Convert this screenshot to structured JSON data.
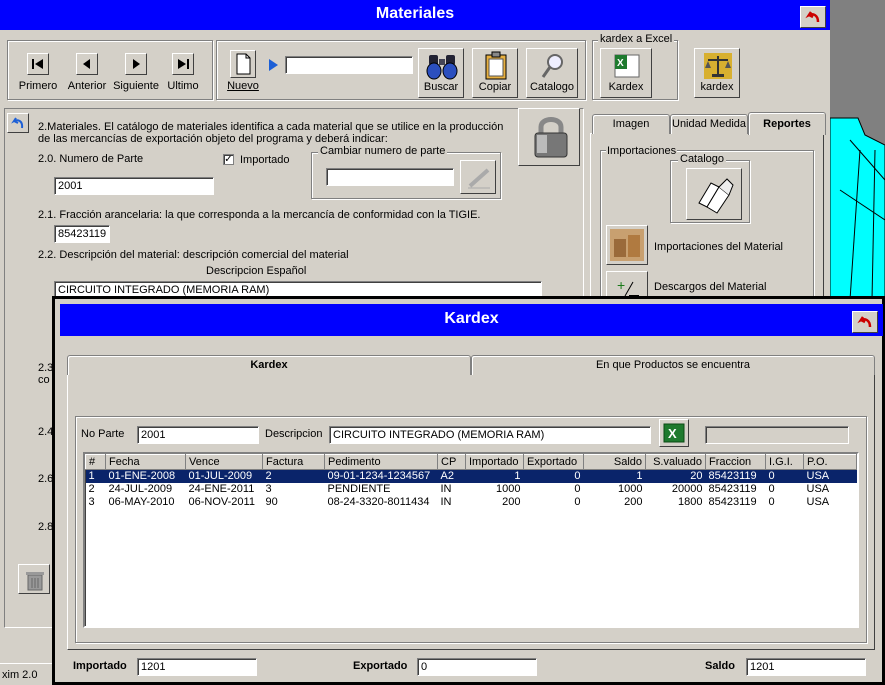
{
  "main_window": {
    "title": "Materiales",
    "nav_buttons": [
      {
        "label": "Primero"
      },
      {
        "label": "Anterior"
      },
      {
        "label": "Siguiente"
      },
      {
        "label": "Ultimo"
      }
    ],
    "new_button": "Nuevo",
    "search_value": "",
    "search_button": "Buscar",
    "copy_button": "Copiar",
    "catalog_button": "Catalogo",
    "kardex_excel_group": "kardex a Excel",
    "kardex_excel_button": "Kardex",
    "kardex_button": "kardex",
    "description": "2.Materiales. El catálogo de materiales identifica a cada material que se utilice en la producción de las mercancías de exportación objeto del programa y deberá indicar:",
    "part_label": "2.0. Numero de Parte",
    "part_value": "2001",
    "importado_check": "Importado",
    "change_part_group": "Cambiar numero de parte",
    "change_part_value": "",
    "fraccion_label": "2.1. Fracción arancelaria: la que corresponda a la mercancía de conformidad con la TIGIE.",
    "fraccion_value": "85423119",
    "desc_label": "2.2. Descripción del material: descripción comercial del material",
    "desc_es_label": "Descripcion Español",
    "desc_es_value": "CIRCUITO INTEGRADO (MEMORIA RAM)",
    "hidden_labels": [
      "2.3",
      "co",
      "2.4",
      "2.6",
      "2.8"
    ],
    "status": "xim 2.0",
    "right_tabs": [
      "Imagen",
      "Unidad Medida",
      "Reportes"
    ],
    "reports_group": "Importaciones",
    "catalog_group": "Catalogo",
    "imports_material": "Importaciones del Material",
    "descargos_material": "Descargos del Material"
  },
  "kardex_window": {
    "title": "Kardex",
    "tabs": [
      "Kardex",
      "En que Productos se encuentra"
    ],
    "no_parte_label": "No Parte",
    "no_parte_value": "2001",
    "descripcion_label": "Descripcion",
    "descripcion_value": "CIRCUITO INTEGRADO (MEMORIA RAM)",
    "columns": [
      "#",
      "Fecha",
      "Vence",
      "Factura",
      "Pedimento",
      "CP",
      "Importado",
      "Exportado",
      "Saldo",
      "S.valuado",
      "Fraccion",
      "I.G.I.",
      "P.O."
    ],
    "rows": [
      [
        "1",
        "01-ENE-2008",
        "01-JUL-2009",
        "2",
        "09-01-1234-1234567",
        "A2",
        "1",
        "0",
        "1",
        "20",
        "85423119",
        "0",
        "USA"
      ],
      [
        "2",
        "24-JUL-2009",
        "24-ENE-2011",
        "3",
        "PENDIENTE",
        "IN",
        "1000",
        "0",
        "1000",
        "20000",
        "85423119",
        "0",
        "USA"
      ],
      [
        "3",
        "06-MAY-2010",
        "06-NOV-2011",
        "90",
        "08-24-3320-8011434",
        "IN",
        "200",
        "0",
        "200",
        "1800",
        "85423119",
        "0",
        "USA"
      ]
    ],
    "importado_label": "Importado",
    "importado_value": "1201",
    "exportado_label": "Exportado",
    "exportado_value": "0",
    "saldo_label": "Saldo",
    "saldo_value": "1201"
  }
}
